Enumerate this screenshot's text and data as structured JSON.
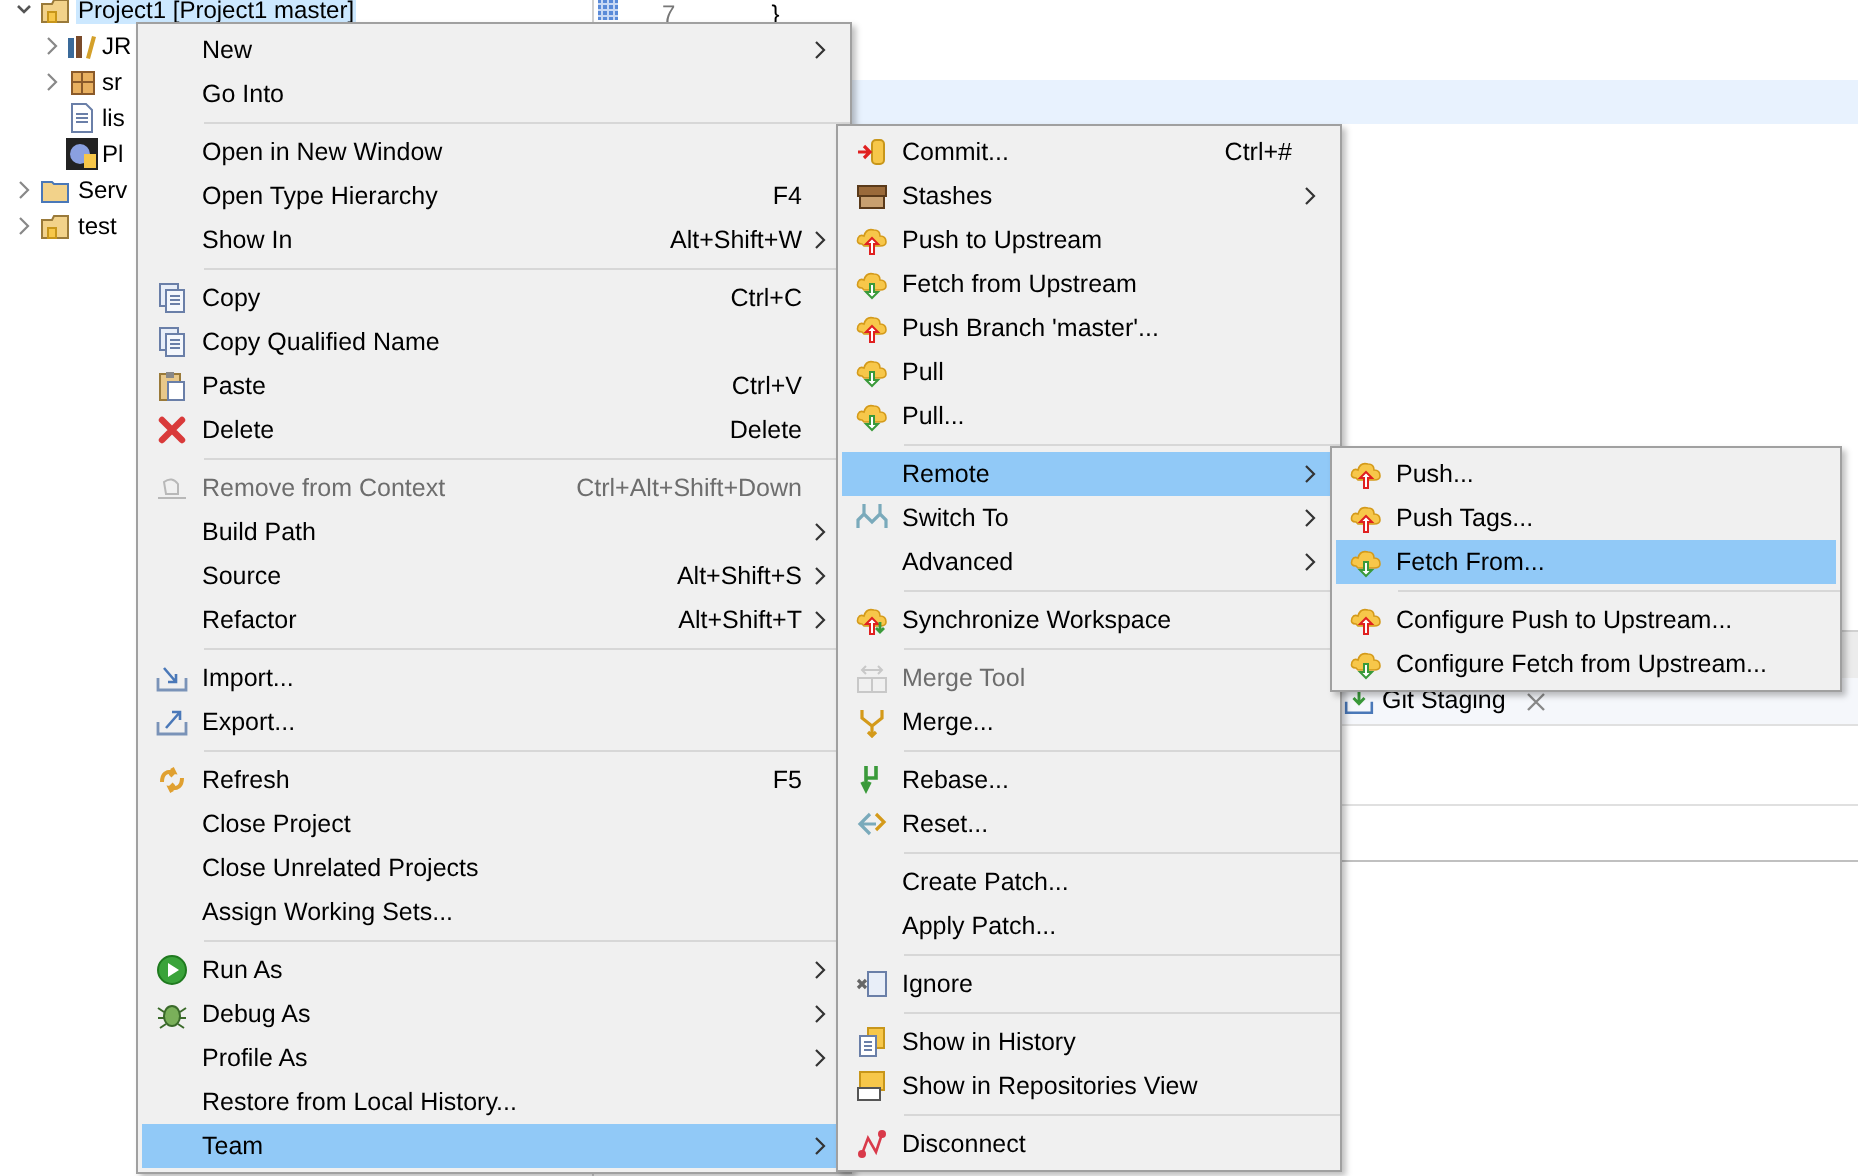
{
  "tree": [
    {
      "label": "Project1 [Project1 master]",
      "selected": true,
      "expanded": true,
      "children": [
        {
          "label": "JR",
          "selected": false,
          "expanded": false
        },
        {
          "label": "sr",
          "selected": false,
          "expanded": false
        },
        {
          "label": "lis",
          "selected": false
        },
        {
          "label": "Pl",
          "selected": false
        }
      ]
    },
    {
      "label": "Serv",
      "selected": false,
      "expanded": false
    },
    {
      "label": "test",
      "selected": false,
      "expanded": false
    }
  ],
  "editor": {
    "line_number": "7",
    "code": "}"
  },
  "bottom_panel": {
    "tab": "Git Staging"
  },
  "context_menu": {
    "items": [
      {
        "kind": "item",
        "label": "New",
        "submenu": true,
        "disabled": false,
        "selected": false
      },
      {
        "kind": "item",
        "label": "Go Into",
        "submenu": false,
        "disabled": false,
        "selected": false
      },
      {
        "kind": "separator"
      },
      {
        "kind": "item",
        "label": "Open in New Window",
        "submenu": false,
        "disabled": false,
        "selected": false
      },
      {
        "kind": "item",
        "label": "Open Type Hierarchy",
        "shortcut": "F4",
        "submenu": false,
        "disabled": false,
        "selected": false
      },
      {
        "kind": "item",
        "label": "Show In",
        "shortcut": "Alt+Shift+W",
        "submenu": true,
        "disabled": false,
        "selected": false
      },
      {
        "kind": "separator"
      },
      {
        "kind": "item",
        "label": "Copy",
        "shortcut": "Ctrl+C",
        "submenu": false,
        "disabled": false,
        "selected": false
      },
      {
        "kind": "item",
        "label": "Copy Qualified Name",
        "submenu": false,
        "disabled": false,
        "selected": false
      },
      {
        "kind": "item",
        "label": "Paste",
        "shortcut": "Ctrl+V",
        "submenu": false,
        "disabled": false,
        "selected": false
      },
      {
        "kind": "item",
        "label": "Delete",
        "shortcut": "Delete",
        "submenu": false,
        "disabled": false,
        "selected": false
      },
      {
        "kind": "separator"
      },
      {
        "kind": "item",
        "label": "Remove from Context",
        "shortcut": "Ctrl+Alt+Shift+Down",
        "submenu": false,
        "disabled": true,
        "selected": false
      },
      {
        "kind": "item",
        "label": "Build Path",
        "submenu": true,
        "disabled": false,
        "selected": false
      },
      {
        "kind": "item",
        "label": "Source",
        "shortcut": "Alt+Shift+S",
        "submenu": true,
        "disabled": false,
        "selected": false
      },
      {
        "kind": "item",
        "label": "Refactor",
        "shortcut": "Alt+Shift+T",
        "submenu": true,
        "disabled": false,
        "selected": false
      },
      {
        "kind": "separator"
      },
      {
        "kind": "item",
        "label": "Import...",
        "submenu": false,
        "disabled": false,
        "selected": false
      },
      {
        "kind": "item",
        "label": "Export...",
        "submenu": false,
        "disabled": false,
        "selected": false
      },
      {
        "kind": "separator"
      },
      {
        "kind": "item",
        "label": "Refresh",
        "shortcut": "F5",
        "submenu": false,
        "disabled": false,
        "selected": false
      },
      {
        "kind": "item",
        "label": "Close Project",
        "submenu": false,
        "disabled": false,
        "selected": false
      },
      {
        "kind": "item",
        "label": "Close Unrelated Projects",
        "submenu": false,
        "disabled": false,
        "selected": false
      },
      {
        "kind": "item",
        "label": "Assign Working Sets...",
        "submenu": false,
        "disabled": false,
        "selected": false
      },
      {
        "kind": "separator"
      },
      {
        "kind": "item",
        "label": "Run As",
        "submenu": true,
        "disabled": false,
        "selected": false
      },
      {
        "kind": "item",
        "label": "Debug As",
        "submenu": true,
        "disabled": false,
        "selected": false
      },
      {
        "kind": "item",
        "label": "Profile As",
        "submenu": true,
        "disabled": false,
        "selected": false
      },
      {
        "kind": "item",
        "label": "Restore from Local History...",
        "submenu": false,
        "disabled": false,
        "selected": false
      },
      {
        "kind": "item",
        "label": "Team",
        "submenu": true,
        "disabled": false,
        "selected": true
      }
    ]
  },
  "team_menu": {
    "items": [
      {
        "kind": "item",
        "label": "Commit...",
        "shortcut": "Ctrl+#",
        "submenu": false,
        "disabled": false,
        "selected": false
      },
      {
        "kind": "item",
        "label": "Stashes",
        "submenu": true,
        "disabled": false,
        "selected": false
      },
      {
        "kind": "item",
        "label": "Push to Upstream",
        "submenu": false,
        "disabled": false,
        "selected": false
      },
      {
        "kind": "item",
        "label": "Fetch from Upstream",
        "submenu": false,
        "disabled": false,
        "selected": false
      },
      {
        "kind": "item",
        "label": "Push Branch 'master'...",
        "submenu": false,
        "disabled": false,
        "selected": false
      },
      {
        "kind": "item",
        "label": "Pull",
        "submenu": false,
        "disabled": false,
        "selected": false
      },
      {
        "kind": "item",
        "label": "Pull...",
        "submenu": false,
        "disabled": false,
        "selected": false
      },
      {
        "kind": "separator"
      },
      {
        "kind": "item",
        "label": "Remote",
        "submenu": true,
        "disabled": false,
        "selected": true
      },
      {
        "kind": "item",
        "label": "Switch To",
        "submenu": true,
        "disabled": false,
        "selected": false
      },
      {
        "kind": "item",
        "label": "Advanced",
        "submenu": true,
        "disabled": false,
        "selected": false
      },
      {
        "kind": "separator"
      },
      {
        "kind": "item",
        "label": "Synchronize Workspace",
        "submenu": false,
        "disabled": false,
        "selected": false
      },
      {
        "kind": "separator"
      },
      {
        "kind": "item",
        "label": "Merge Tool",
        "submenu": false,
        "disabled": true,
        "selected": false
      },
      {
        "kind": "item",
        "label": "Merge...",
        "submenu": false,
        "disabled": false,
        "selected": false
      },
      {
        "kind": "separator"
      },
      {
        "kind": "item",
        "label": "Rebase...",
        "submenu": false,
        "disabled": false,
        "selected": false
      },
      {
        "kind": "item",
        "label": "Reset...",
        "submenu": false,
        "disabled": false,
        "selected": false
      },
      {
        "kind": "separator"
      },
      {
        "kind": "item",
        "label": "Create Patch...",
        "submenu": false,
        "disabled": false,
        "selected": false
      },
      {
        "kind": "item",
        "label": "Apply Patch...",
        "submenu": false,
        "disabled": false,
        "selected": false
      },
      {
        "kind": "separator"
      },
      {
        "kind": "item",
        "label": "Ignore",
        "submenu": false,
        "disabled": false,
        "selected": false
      },
      {
        "kind": "separator"
      },
      {
        "kind": "item",
        "label": "Show in History",
        "submenu": false,
        "disabled": false,
        "selected": false
      },
      {
        "kind": "item",
        "label": "Show in Repositories View",
        "submenu": false,
        "disabled": false,
        "selected": false
      },
      {
        "kind": "separator"
      },
      {
        "kind": "item",
        "label": "Disconnect",
        "submenu": false,
        "disabled": false,
        "selected": false
      }
    ]
  },
  "remote_menu": {
    "items": [
      {
        "kind": "item",
        "label": "Push...",
        "submenu": false,
        "disabled": false,
        "selected": false
      },
      {
        "kind": "item",
        "label": "Push Tags...",
        "submenu": false,
        "disabled": false,
        "selected": false
      },
      {
        "kind": "item",
        "label": "Fetch From...",
        "submenu": false,
        "disabled": false,
        "selected": true
      },
      {
        "kind": "separator"
      },
      {
        "kind": "item",
        "label": "Configure Push to Upstream...",
        "submenu": false,
        "disabled": false,
        "selected": false
      },
      {
        "kind": "item",
        "label": "Configure Fetch from Upstream...",
        "submenu": false,
        "disabled": false,
        "selected": false
      }
    ]
  }
}
